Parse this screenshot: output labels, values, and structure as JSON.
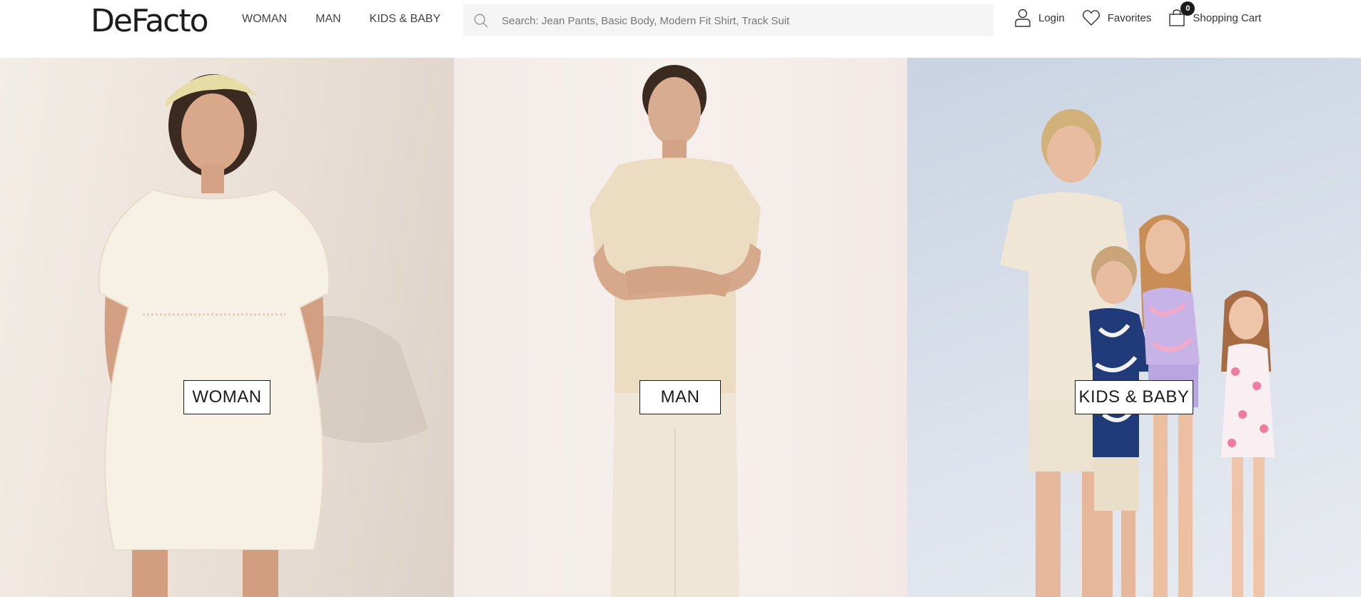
{
  "header": {
    "logo": "DeFacto",
    "nav": [
      "WOMAN",
      "MAN",
      "KIDS & BABY"
    ],
    "search_placeholder": "Search: Jean Pants, Basic Body, Modern Fit Shirt, Track Suit",
    "login_label": "Login",
    "favorites_label": "Favorites",
    "cart_label": "Shopping Cart",
    "cart_count": "0"
  },
  "categories": [
    {
      "label": "WOMAN"
    },
    {
      "label": "MAN"
    },
    {
      "label": "KIDS & BABY"
    }
  ]
}
